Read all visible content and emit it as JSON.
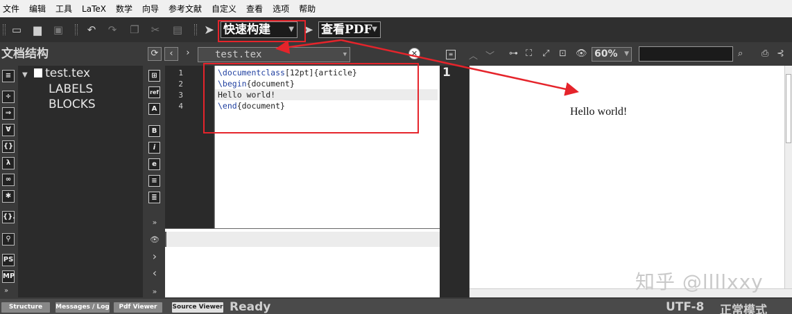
{
  "menu": [
    "文件",
    "编辑",
    "工具",
    "LaTeX",
    "数学",
    "向导",
    "参考文献",
    "自定义",
    "查看",
    "选项",
    "帮助"
  ],
  "toolbar": {
    "build_label": "快速构建",
    "view_label": "查看PDF"
  },
  "structure": {
    "title": "文档结构",
    "file": "test.tex",
    "items": [
      "LABELS",
      "BLOCKS"
    ]
  },
  "editor": {
    "tab_file": "test.tex",
    "lines": [
      {
        "num": "1",
        "cmd": "\\documentclass",
        "rest": "[12pt]{article}"
      },
      {
        "num": "2",
        "cmd": "\\begin",
        "rest": "{document}"
      },
      {
        "num": "3",
        "cmd": "",
        "rest": "Hello world!"
      },
      {
        "num": "4",
        "cmd": "\\end",
        "rest": "{document}"
      }
    ]
  },
  "pdf": {
    "page_number": "1",
    "zoom": "60%",
    "content": "Hello world!"
  },
  "watermark": "知乎 @llllxxy",
  "statusbar": {
    "tabs": [
      "Structure",
      "Messages / Log",
      "Pdf Viewer",
      "Source Viewer"
    ],
    "status": "Ready",
    "encoding": "UTF-8",
    "mode": "正常模式"
  },
  "colors": {
    "annotation_red": "#e5242b",
    "keyword_blue": "#1f3fa0"
  }
}
